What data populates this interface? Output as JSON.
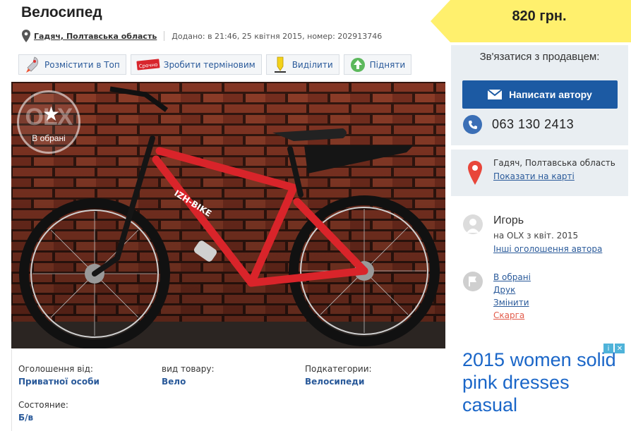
{
  "listing": {
    "title": "Велосипед",
    "city": "Гадяч, Полтавська область",
    "meta": "Додано: в 21:46, 25 квітня 2015, номер: 202913746"
  },
  "actions": [
    {
      "label": "Розмістити в Топ",
      "icon": "rocket-icon"
    },
    {
      "label": "Зробити терміновим",
      "icon": "urgent-stamp-icon",
      "badge": "Срочно"
    },
    {
      "label": "Виділити",
      "icon": "highlighter-icon"
    },
    {
      "label": "Підняти",
      "icon": "up-arrow-icon"
    }
  ],
  "photo": {
    "favorite_label": "В обрані",
    "logo_text": "OLX",
    "frame_text": "IZH-BIKE"
  },
  "details": [
    {
      "key": "Оголошення від:",
      "value": "Приватної особи"
    },
    {
      "key": "вид товару:",
      "value": "Вело"
    },
    {
      "key": "Подкатегории:",
      "value": "Велосипеди"
    },
    {
      "key": "Состояние:",
      "value": "Б/в"
    }
  ],
  "price": "820 грн.",
  "contact": {
    "title": "Зв'язатися з продавцем:",
    "message_button": "Написати автору",
    "phone": "063 130 2413"
  },
  "location": {
    "city": "Гадяч, Полтавська область",
    "map_link": "Показати на карті"
  },
  "seller": {
    "name": "Игорь",
    "since": "на OLX з квіт. 2015",
    "other_ads": "Інші оголошення автора"
  },
  "options": {
    "favorite": "В обрані",
    "print": "Друк",
    "edit": "Змінити",
    "report": "Скарга"
  },
  "ad": {
    "text": "2015 women solid pink dresses casual"
  },
  "colors": {
    "price_tag": "#fff06d",
    "primary_button": "#1c5aa3",
    "link": "#2a5a9a",
    "panel": "#e9eef2",
    "report": "#e25b4a",
    "bike_frame": "#d9242a"
  }
}
